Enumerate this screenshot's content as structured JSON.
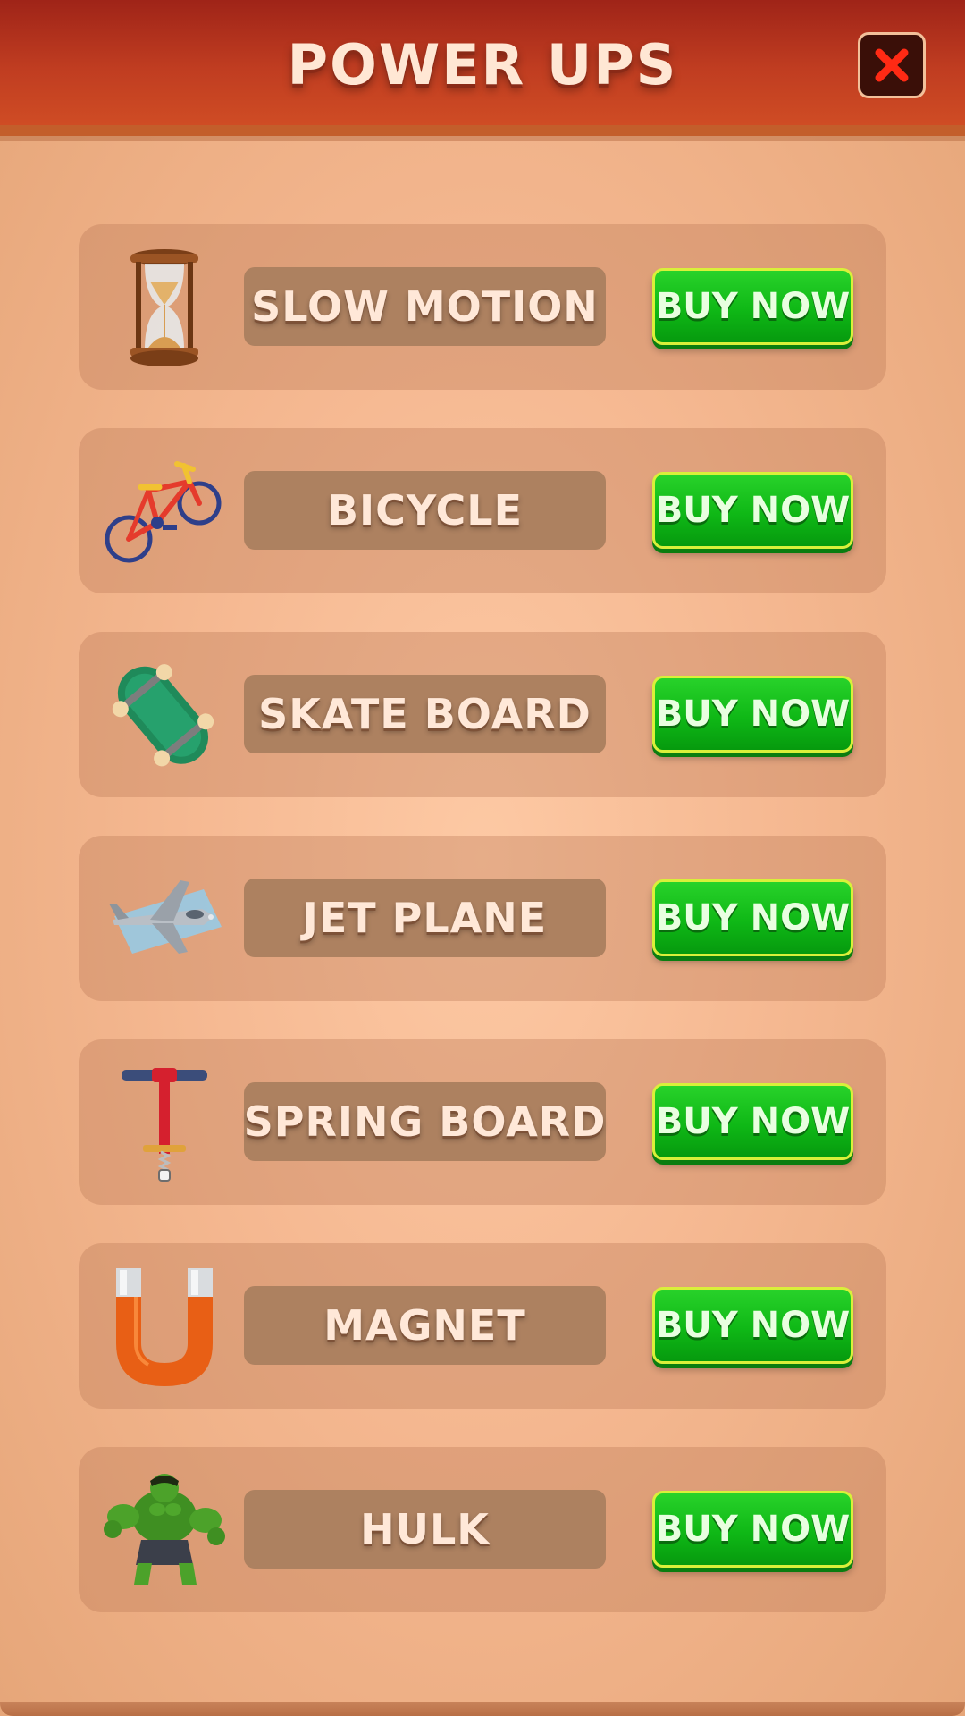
{
  "header": {
    "title": "POWER UPS",
    "close_icon": "close-icon"
  },
  "colors": {
    "header": "#c03d21",
    "background": "#f5b891",
    "buy_button": "#0fb816",
    "name_plate": "#ad8160"
  },
  "items": [
    {
      "name": "SLOW MOTION",
      "button": "BUY NOW",
      "icon": "hourglass-icon"
    },
    {
      "name": "BICYCLE",
      "button": "BUY NOW",
      "icon": "bicycle-icon"
    },
    {
      "name": "SKATE BOARD",
      "button": "BUY NOW",
      "icon": "skateboard-icon"
    },
    {
      "name": "JET PLANE",
      "button": "BUY NOW",
      "icon": "jet-plane-icon"
    },
    {
      "name": "SPRING BOARD",
      "button": "BUY NOW",
      "icon": "pogo-stick-icon"
    },
    {
      "name": "MAGNET",
      "button": "BUY NOW",
      "icon": "magnet-icon"
    },
    {
      "name": "HULK",
      "button": "BUY NOW",
      "icon": "hulk-icon"
    }
  ]
}
